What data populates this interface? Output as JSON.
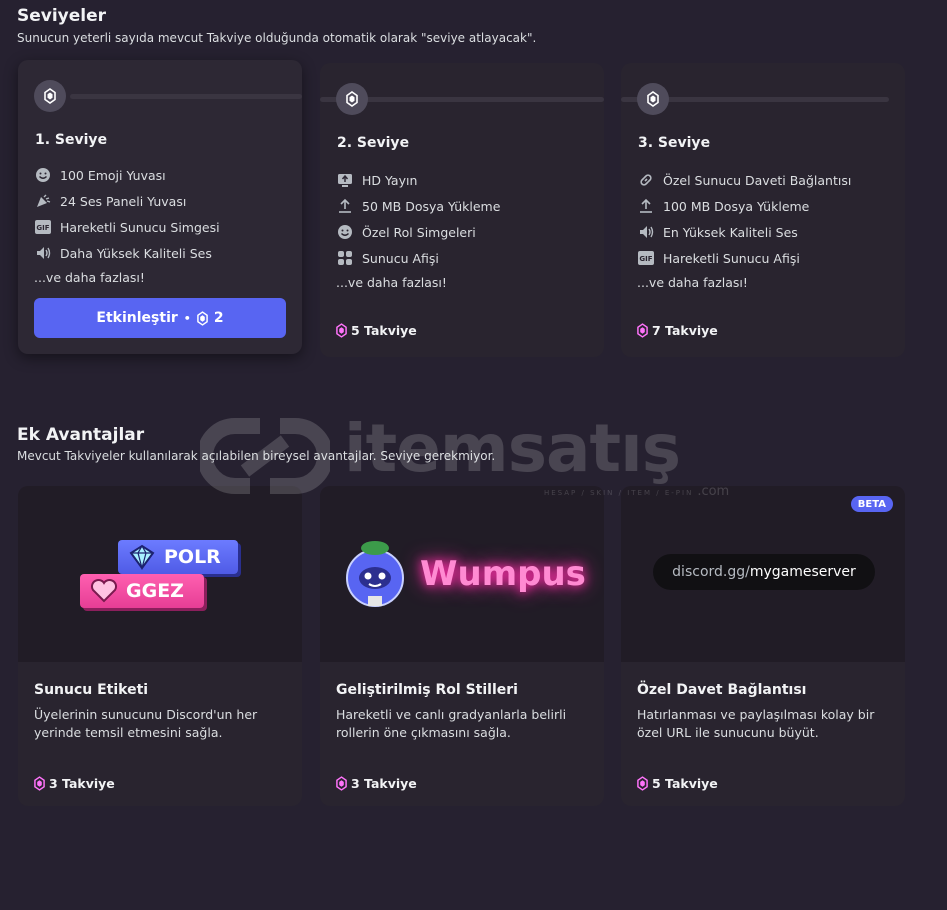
{
  "levels": {
    "title": "Seviyeler",
    "subtitle": "Sunucun yeterli sayıda mevcut Takviye olduğunda otomatik olarak \"seviye atlayacak\".",
    "tiers": [
      {
        "name": "1. Seviye",
        "perks": [
          {
            "icon": "emoji-icon",
            "label": "100 Emoji Yuvası"
          },
          {
            "icon": "soundboard-icon",
            "label": "24 Ses Paneli Yuvası"
          },
          {
            "icon": "gif-icon",
            "label": "Hareketli Sunucu Simgesi"
          },
          {
            "icon": "speaker-icon",
            "label": "Daha Yüksek Kaliteli Ses"
          }
        ],
        "more": "...ve daha fazlası!",
        "button_label": "Etkinleştir",
        "button_separator": "•",
        "button_cost": "2"
      },
      {
        "name": "2. Seviye",
        "perks": [
          {
            "icon": "stream-icon",
            "label": "HD Yayın"
          },
          {
            "icon": "upload-icon",
            "label": "50 MB Dosya Yükleme"
          },
          {
            "icon": "emoji-icon",
            "label": "Özel Rol Simgeleri"
          },
          {
            "icon": "grid-icon",
            "label": "Sunucu Afişi"
          }
        ],
        "more": "...ve daha fazlası!",
        "cost": "5 Takviye"
      },
      {
        "name": "3. Seviye",
        "perks": [
          {
            "icon": "link-icon",
            "label": "Özel Sunucu Daveti Bağlantısı"
          },
          {
            "icon": "upload-icon",
            "label": "100 MB Dosya Yükleme"
          },
          {
            "icon": "speaker-icon",
            "label": "En Yüksek Kaliteli Ses"
          },
          {
            "icon": "gif-icon",
            "label": "Hareketli Sunucu Afişi"
          }
        ],
        "more": "...ve daha fazlası!",
        "cost": "7 Takviye"
      }
    ]
  },
  "extras": {
    "title": "Ek Avantajlar",
    "subtitle": "Mevcut Takviyeler kullanılarak açılabilen bireysel avantajlar. Seviye gerekmiyor.",
    "cards": [
      {
        "name": "Sunucu Etiketi",
        "description": "Üyelerinin sunucunu Discord'un her yerinde temsil etmesini sağla.",
        "cost": "3 Takviye",
        "preview": {
          "tag1": "POLR",
          "tag2": "GGEZ"
        }
      },
      {
        "name": "Geliştirilmiş Rol Stilleri",
        "description": "Hareketli ve canlı gradyanlarla belirli rollerin öne çıkmasını sağla.",
        "cost": "3 Takviye",
        "preview": {
          "text": "Wumpus"
        }
      },
      {
        "name": "Özel Davet Bağlantısı",
        "description": "Hatırlanması ve paylaşılması kolay bir özel URL ile sunucunu büyüt.",
        "cost": "5 Takviye",
        "badge": "BETA",
        "preview": {
          "invite_prefix": "discord.gg/",
          "invite_slug": "mygameserver"
        }
      }
    ]
  },
  "watermark": {
    "brand": "itemsatış",
    "tagline": "HESAP / SKIN / ITEM / E-PIN",
    "domain": ".com"
  },
  "colors": {
    "accent": "#5865f2",
    "boost_pink": "#ff73fa",
    "background": "#262130"
  }
}
